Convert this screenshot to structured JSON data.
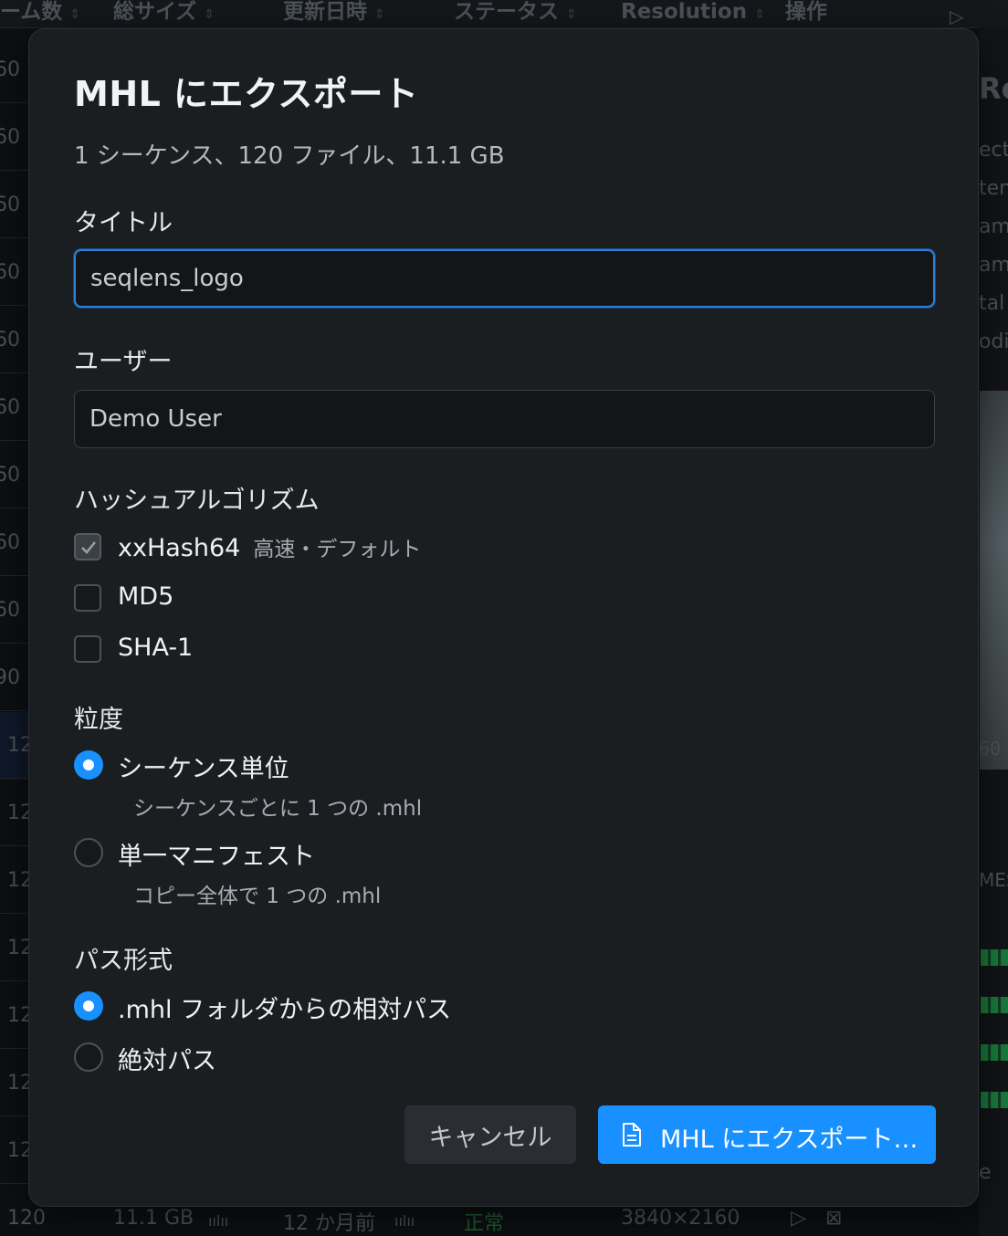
{
  "background": {
    "columns": [
      "ーム数",
      "総サイズ",
      "更新日時",
      "ステータス",
      "Resolution",
      "操作"
    ],
    "row_numbers": [
      "60",
      "60",
      "60",
      "60",
      "60",
      "60",
      "60",
      "60",
      "60",
      "90",
      "12",
      "12",
      "12",
      "12",
      "12",
      "12",
      "12"
    ],
    "right_fragments": [
      "Re",
      "ect",
      "ten",
      "ame",
      "ame",
      "tal s",
      "odif",
      "60",
      "MES",
      "e"
    ],
    "bottom_row": {
      "frames": "120",
      "size": "11.1 GB",
      "modified": "12 か月前",
      "status": "正常",
      "resolution": "3840×2160"
    }
  },
  "dialog": {
    "title": "MHL にエクスポート",
    "summary": "1 シーケンス、120 ファイル、11.1 GB",
    "title_field": {
      "label": "タイトル",
      "value": "seqlens_logo"
    },
    "user_field": {
      "label": "ユーザー",
      "value": "Demo User"
    },
    "hash": {
      "label": "ハッシュアルゴリズム",
      "options": [
        {
          "label": "xxHash64",
          "hint": "高速・デフォルト",
          "checked": true
        },
        {
          "label": "MD5",
          "checked": false
        },
        {
          "label": "SHA-1",
          "checked": false
        }
      ]
    },
    "granularity": {
      "label": "粒度",
      "options": [
        {
          "label": "シーケンス単位",
          "description": "シーケンスごとに 1 つの .mhl",
          "selected": true
        },
        {
          "label": "単一マニフェスト",
          "description": "コピー全体で 1 つの .mhl",
          "selected": false
        }
      ]
    },
    "path_format": {
      "label": "パス形式",
      "options": [
        {
          "label": ".mhl フォルダからの相対パス",
          "selected": true
        },
        {
          "label": "絶対パス",
          "selected": false
        }
      ]
    },
    "cancel_label": "キャンセル",
    "export_label": "MHL にエクスポート…",
    "accent_color": "#1890ff"
  }
}
